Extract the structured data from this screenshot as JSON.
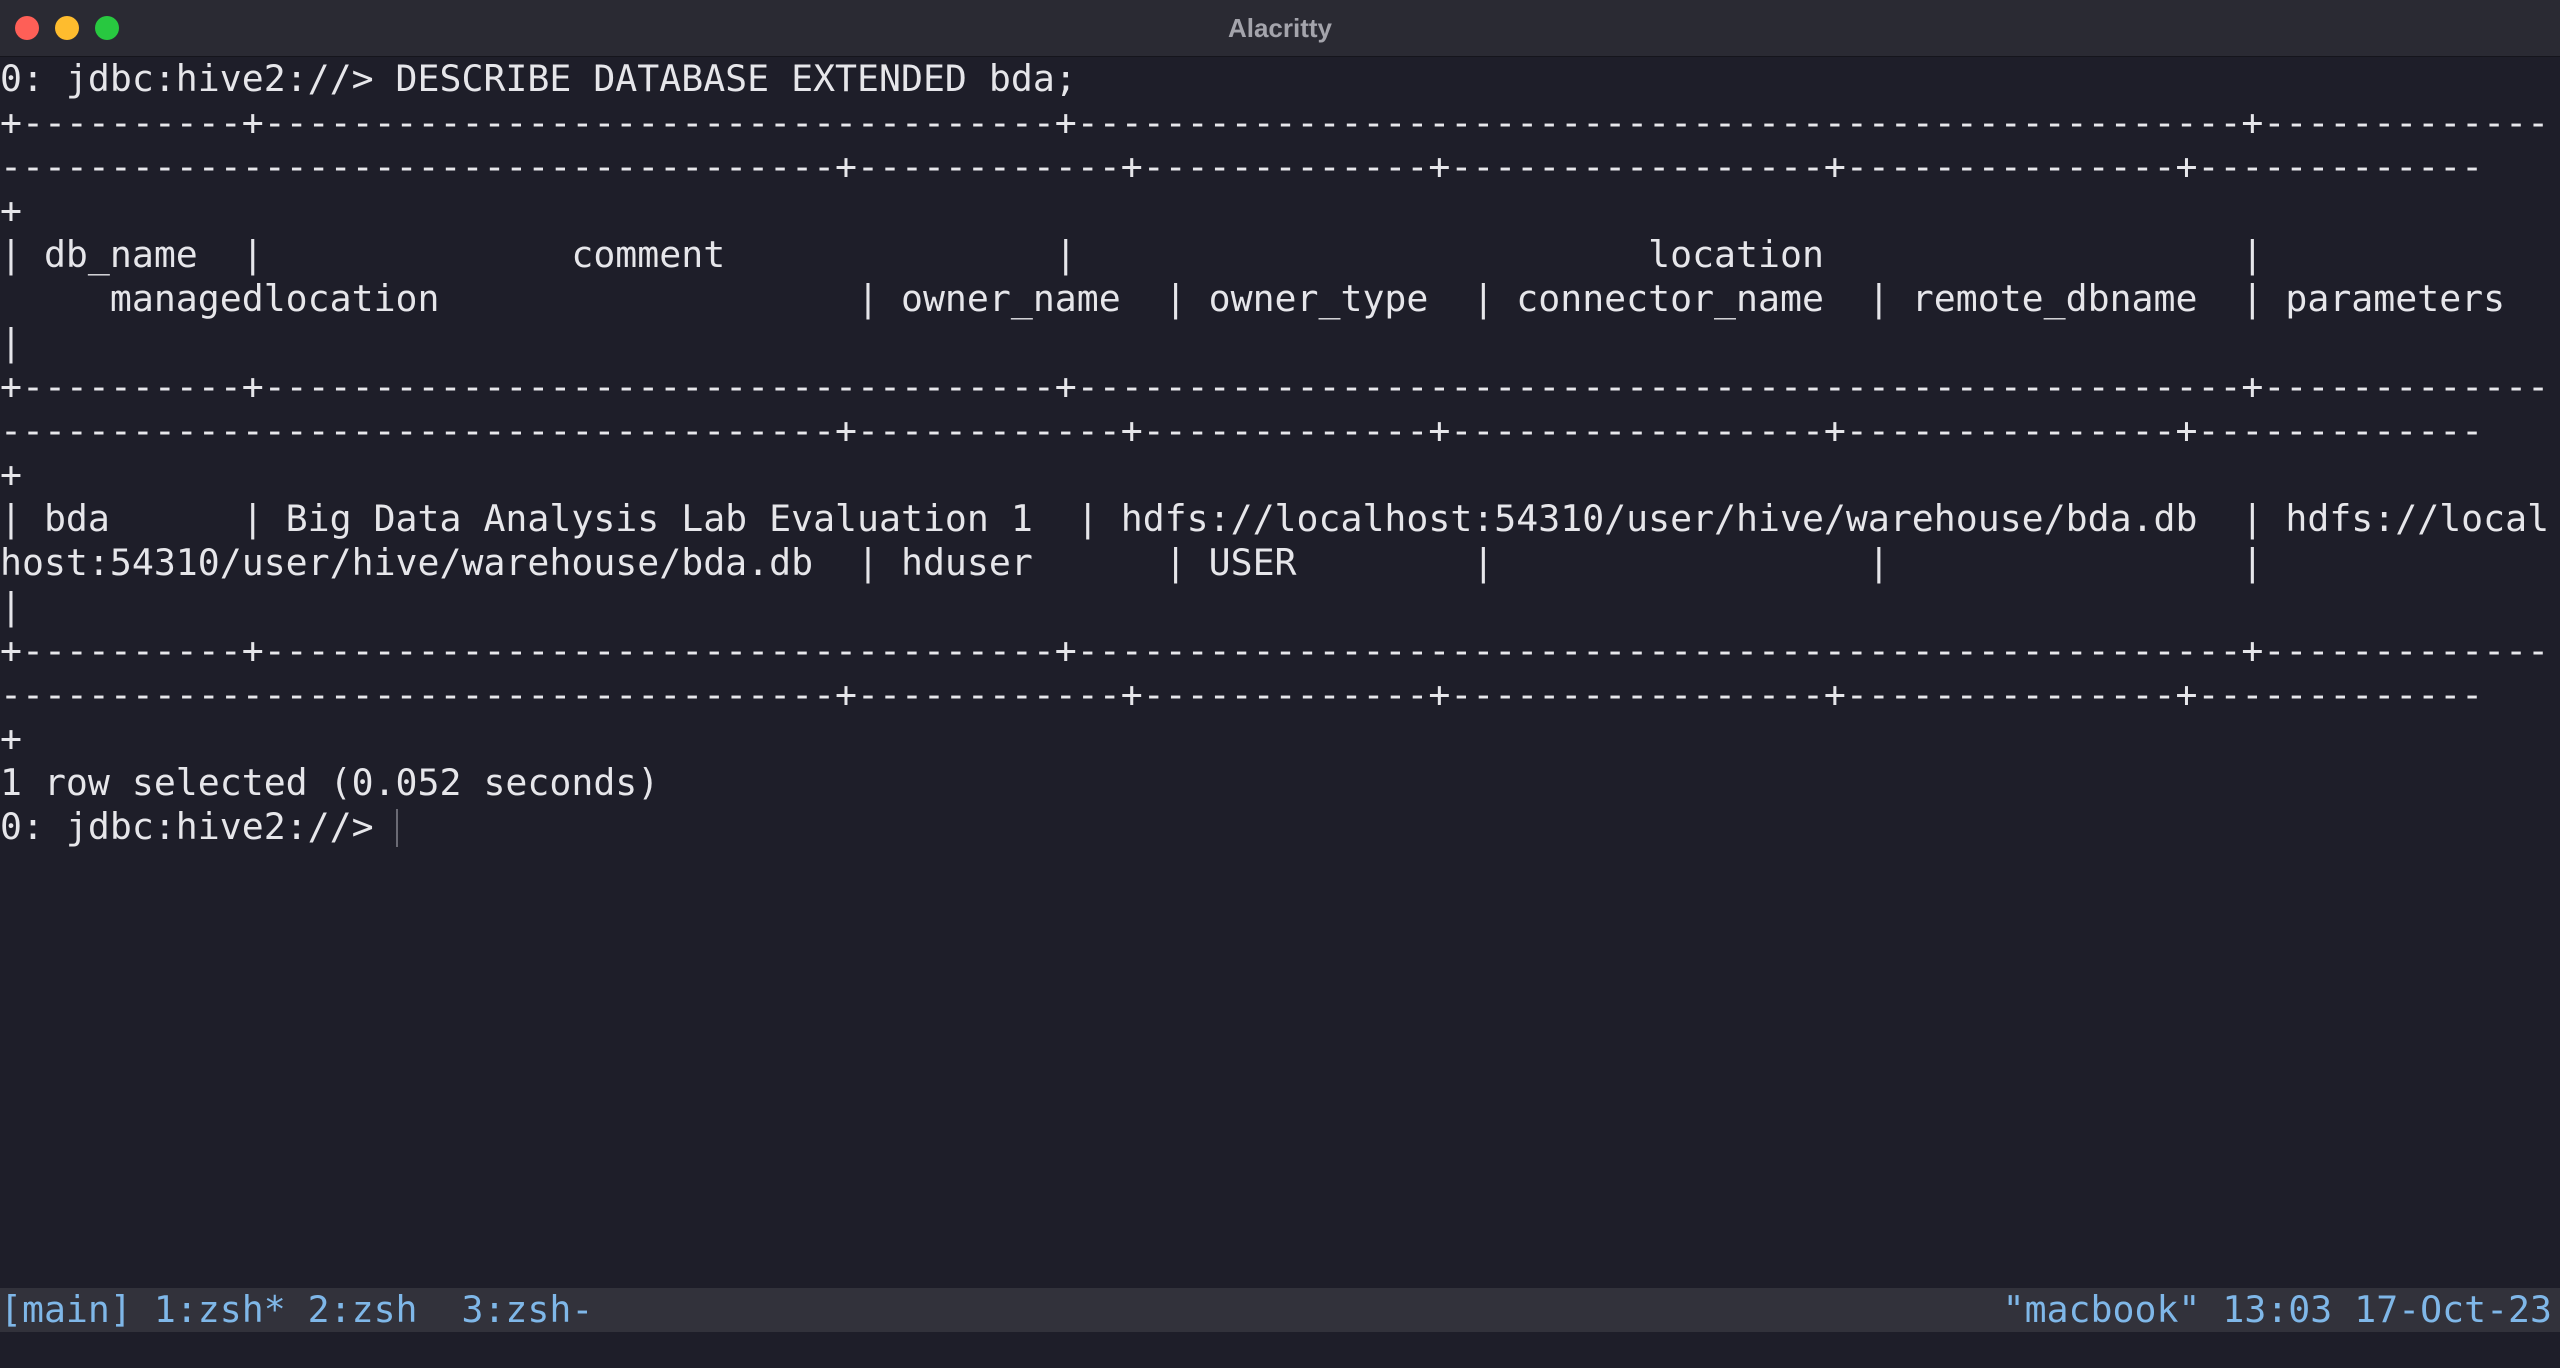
{
  "window": {
    "title": "Alacritty"
  },
  "terminal": {
    "lines": [
      "0: jdbc:hive2://> DESCRIBE DATABASE EXTENDED bda;",
      "+----------+------------------------------------+-----------------------------------------------------+-------------",
      "--------------------------------------+------------+-------------+-----------------+---------------+-------------",
      "+",
      "| db_name  |              comment               |                          location                   |",
      "     managedlocation                   | owner_name  | owner_type  | connector_name  | remote_dbname  | parameters",
      "|",
      "+----------+------------------------------------+-----------------------------------------------------+-------------",
      "--------------------------------------+------------+-------------+-----------------+---------------+-------------",
      "+",
      "| bda      | Big Data Analysis Lab Evaluation 1  | hdfs://localhost:54310/user/hive/warehouse/bda.db  | hdfs://local",
      "host:54310/user/hive/warehouse/bda.db  | hduser      | USER        |                 |                |",
      "|",
      "+----------+------------------------------------+-----------------------------------------------------+-------------",
      "--------------------------------------+------------+-------------+-----------------+---------------+-------------",
      "+",
      "1 row selected (0.052 seconds)",
      "0: jdbc:hive2://> "
    ]
  },
  "statusbar": {
    "left": "[main] 1:zsh* 2:zsh  3:zsh-",
    "right": "\"macbook\" 13:03 17-Oct-23"
  },
  "colors": {
    "background": "#1e1e29",
    "foreground": "#e6e6ea",
    "titlebar": "#2a2a33",
    "statusbar_bg": "#32323b",
    "statusbar_fg": "#7fb7e8"
  }
}
